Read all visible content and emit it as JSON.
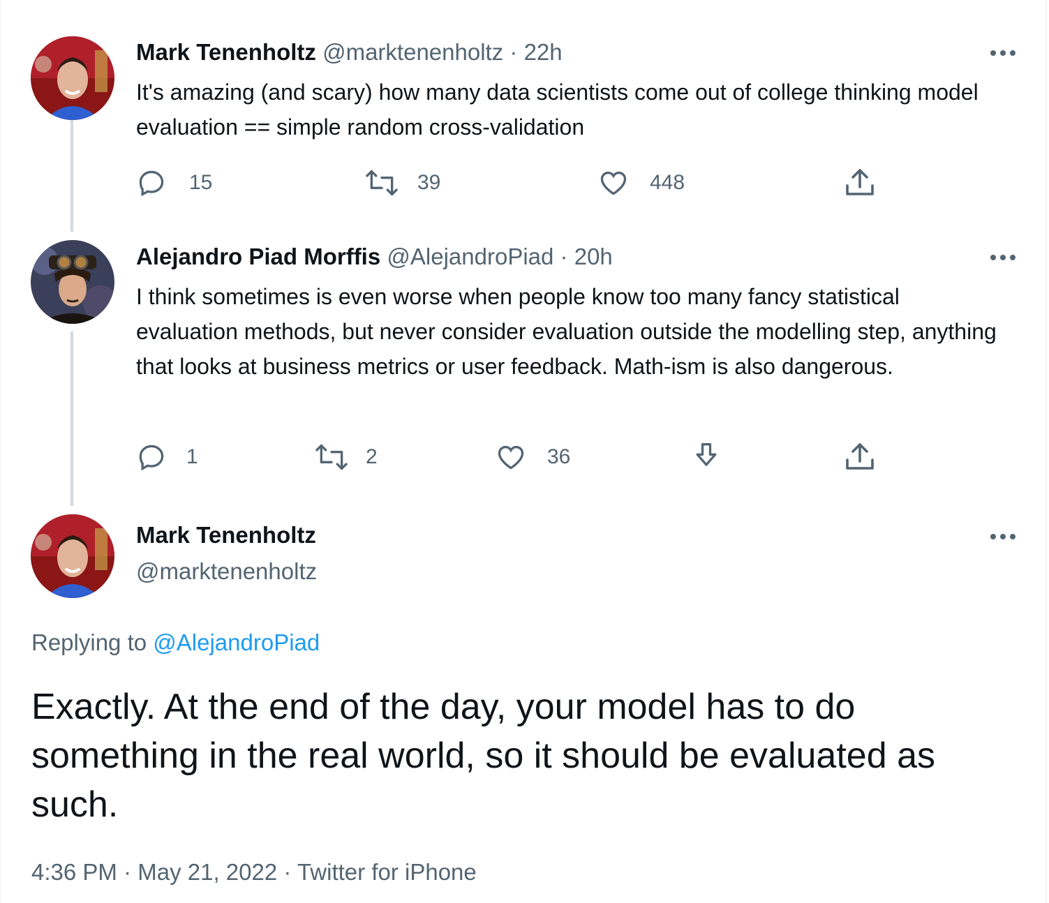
{
  "tweets": [
    {
      "name": "Mark Tenenholtz",
      "handle": "@marktenenholtz",
      "time": "22h",
      "text": "It's amazing (and scary) how many data scientists come out of college thinking model evaluation == simple random cross-validation",
      "replies": "15",
      "retweets": "39",
      "likes": "448"
    },
    {
      "name": "Alejandro Piad Morffis",
      "handle": "@AlejandroPiad",
      "time": "20h",
      "text": "I think sometimes is even worse when people know too many fancy statistical evaluation methods, but never consider evaluation outside the modelling step, anything that looks at business metrics or user feedback. Math-ism is also dangerous.",
      "replies": "1",
      "retweets": "2",
      "likes": "36"
    }
  ],
  "main": {
    "name": "Mark Tenenholtz",
    "handle": "@marktenenholtz",
    "replying_prefix": "Replying to",
    "replying_to": "@AlejandroPiad",
    "text": "Exactly. At the end of the day, your model has to do something in the real world, so it should be evaluated as such.",
    "time": "4:36 PM",
    "date": "May 21, 2022",
    "source": "Twitter for iPhone",
    "separator": "·"
  },
  "colors": {
    "link": "#1d9bf0",
    "secondary": "#536471",
    "thread_line": "#cfd9de"
  },
  "icons": [
    "reply-icon",
    "retweet-icon",
    "like-icon",
    "download-icon",
    "share-icon",
    "more-icon"
  ]
}
